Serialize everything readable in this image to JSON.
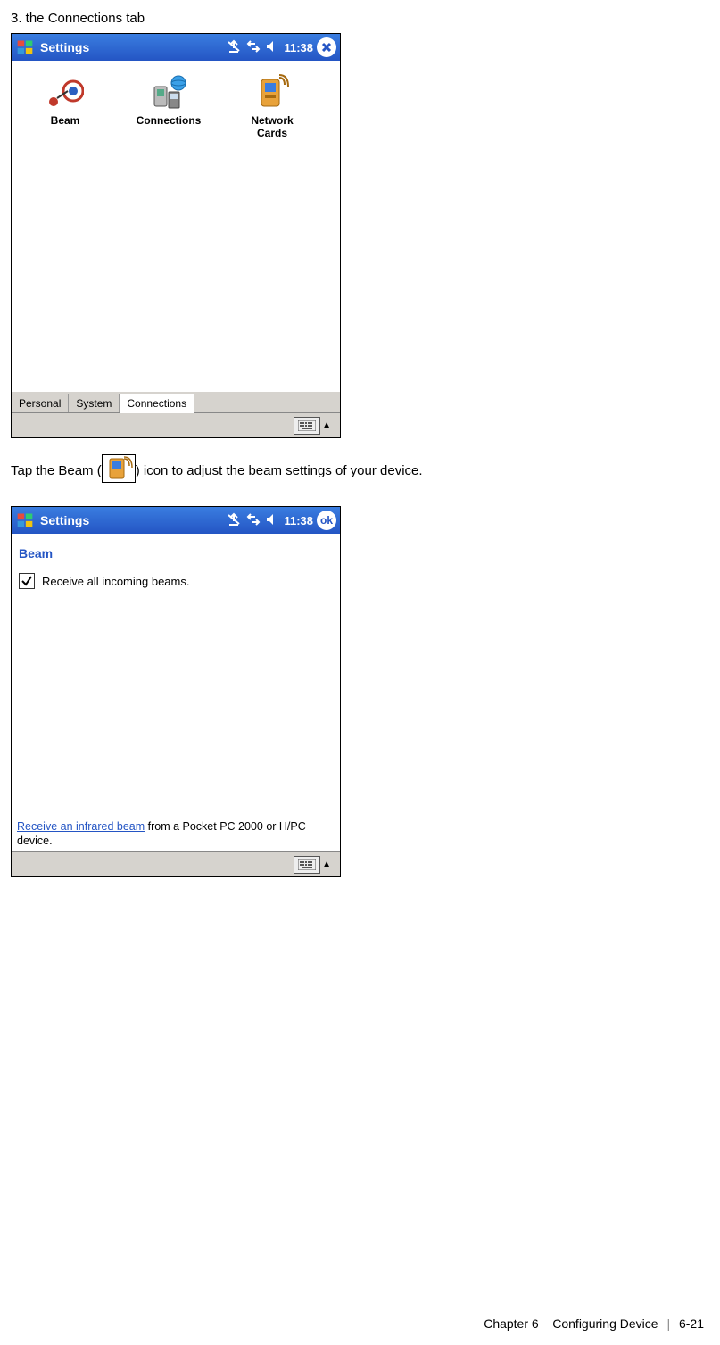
{
  "doc": {
    "heading": "3. the Connections tab",
    "beam_line_before": "Tap the Beam (",
    "beam_line_after": ") icon to adjust the beam settings of your device.",
    "footer_chapter": "Chapter 6",
    "footer_title": "Configuring Device",
    "footer_page": "6-21"
  },
  "shot1": {
    "titlebar": {
      "title": "Settings",
      "time": "11:38"
    },
    "icons": {
      "beam": "Beam",
      "connections": "Connections",
      "network_cards_line1": "Network",
      "network_cards_line2": "Cards"
    },
    "tabs": {
      "personal": "Personal",
      "system": "System",
      "connections": "Connections"
    }
  },
  "shot2": {
    "titlebar": {
      "title": "Settings",
      "time": "11:38",
      "ok": "ok"
    },
    "header": "Beam",
    "checkbox_label": "Receive all incoming beams.",
    "link_text": "Receive an infrared beam",
    "rest_text": " from a Pocket PC 2000 or H/PC device."
  }
}
